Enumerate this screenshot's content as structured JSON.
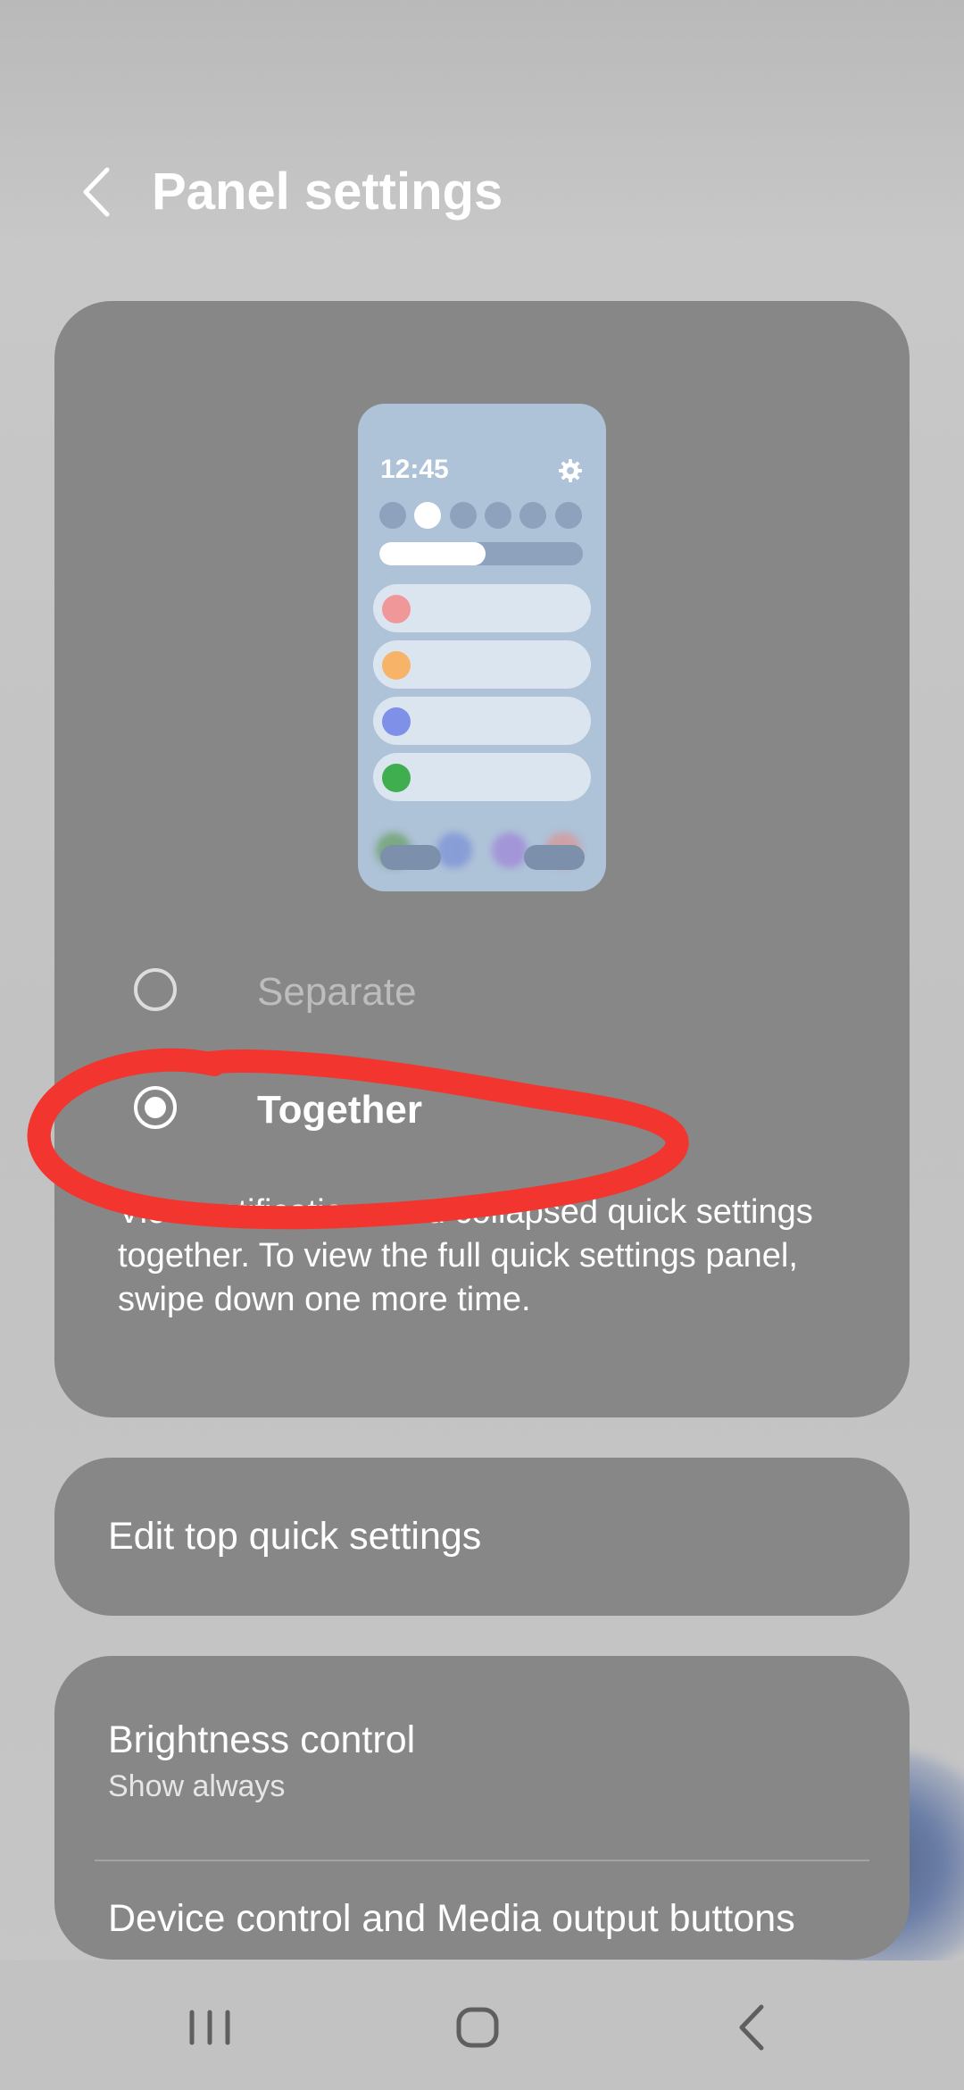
{
  "header": {
    "title": "Panel settings"
  },
  "preview": {
    "time": "12:45",
    "brightness_level": 0.52,
    "tile_colors": [
      "#f0979a",
      "#f7b469",
      "#7f90e8",
      "#3eae4f"
    ]
  },
  "options": {
    "separate_label": "Separate",
    "together_label": "Together",
    "selected": "Together",
    "description": "View notifications and collapsed quick settings together. To view the full quick settings panel, swipe down one more time."
  },
  "edit_card": {
    "label": "Edit top quick settings"
  },
  "brightness": {
    "label": "Brightness control",
    "value": "Show always"
  },
  "device_control": {
    "label": "Device control and Media output buttons"
  },
  "colors": {
    "card_bg": "#878787",
    "annotation": "#f2352e",
    "page_bg": "#c4c4c4"
  },
  "nav": {
    "icons": [
      "recent-apps-icon",
      "home-icon",
      "back-icon"
    ]
  }
}
